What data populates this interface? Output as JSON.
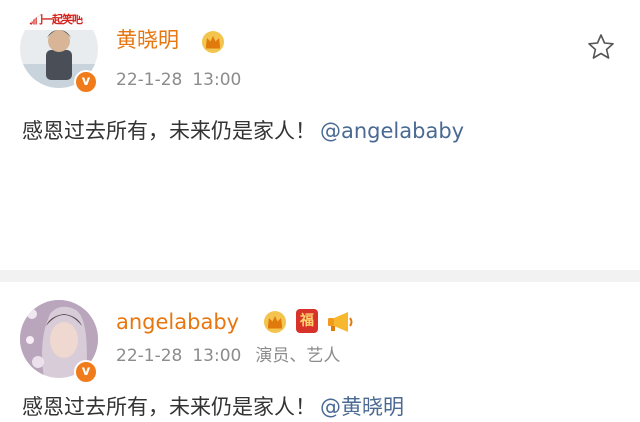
{
  "posts": [
    {
      "avatar_banner_text": "我们一起笑吧",
      "username": "黄晓明",
      "date": "22-1-28",
      "time": "13:00",
      "role": "",
      "content_text": "感恩过去所有，未来仍是家人！",
      "mention": "@angelababy",
      "verify_badge": "v",
      "icons": [
        "crown-icon",
        "star-icon"
      ]
    },
    {
      "username": "angelababy",
      "date": "22-1-28",
      "time": "13:00",
      "role": "演员、艺人",
      "content_text": "感恩过去所有，未来仍是家人！",
      "mention": "@黄晓明",
      "verify_badge": "v",
      "fu_text": "福",
      "icons": [
        "crown-icon",
        "fu-badge-icon",
        "megaphone-icon"
      ]
    }
  ],
  "colors": {
    "username": "#e8760f",
    "meta": "#8c8c8c",
    "mention": "#4a6a93",
    "verify": "#f07b1a",
    "separator": "#f2f2f2"
  }
}
